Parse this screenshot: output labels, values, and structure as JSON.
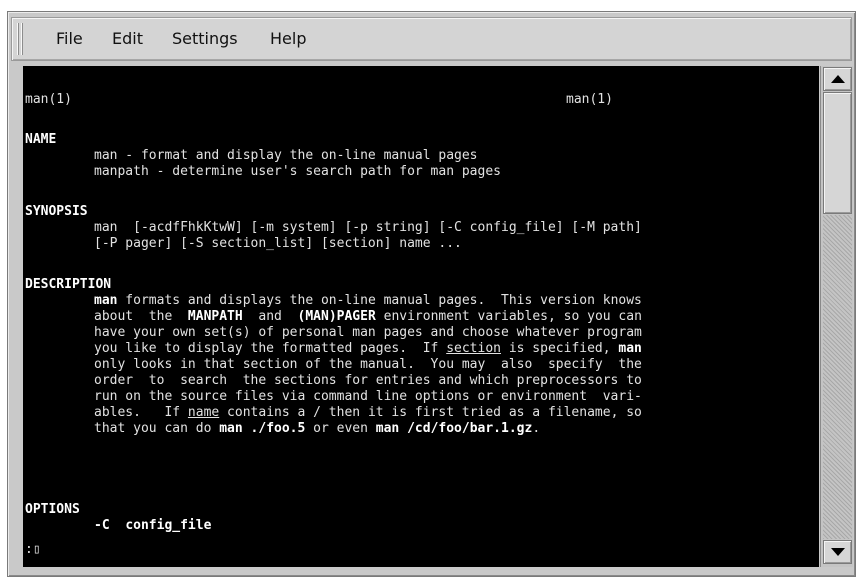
{
  "menu": {
    "items": [
      "File",
      "Edit",
      "Settings",
      "Help"
    ]
  },
  "terminal": {
    "header_left": "man(1)",
    "header_right": "man(1)",
    "name": {
      "heading": "NAME",
      "lines": [
        "man - format and display the on-line manual pages",
        "manpath - determine user's search path for man pages"
      ]
    },
    "synopsis": {
      "heading": "SYNOPSIS",
      "lines": [
        "man  [-acdfFhkKtwW] [-m system] [-p string] [-C config_file] [-M path]",
        "[-P pager] [-S section_list] [section] name ..."
      ]
    },
    "description": {
      "heading": "DESCRIPTION",
      "l1": {
        "a": "man",
        "b": " formats and displays the on-line manual pages.  This version knows"
      },
      "l2": {
        "a": "about  the  ",
        "b": "MANPATH",
        "c": "  and  ",
        "d": "(MAN)PAGER",
        "e": " environment variables, so you can"
      },
      "l3": "have your own set(s) of personal man pages and choose whatever program",
      "l4": {
        "a": "you like to display the formatted pages.  If ",
        "b": "section",
        "c": " is specified, ",
        "d": "man"
      },
      "l5": "only looks in that section of the manual.  You may  also  specify  the",
      "l6": "order  to  search  the sections for entries and which preprocessors to",
      "l7": "run on the source files via command line options or environment  vari-",
      "l8": {
        "a": "ables.   If ",
        "b": "name",
        "c": " contains a / then it is first tried as a filename, so"
      },
      "l9": {
        "a": "that you can do ",
        "b": "man ./foo.5",
        "c": " or even ",
        "d": "man /cd/foo/bar.1.gz",
        "e": "."
      }
    },
    "options": {
      "heading": "OPTIONS",
      "flag": "-C",
      "arg": "config_file"
    },
    "prompt": ":▯"
  },
  "scrollbar": {
    "thumb_position": 0.0,
    "visible_fraction": 0.25
  }
}
